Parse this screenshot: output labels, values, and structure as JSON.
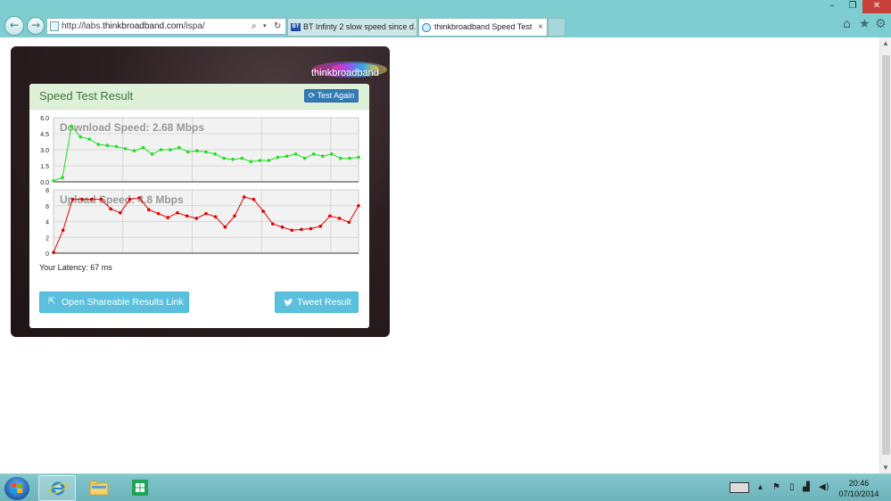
{
  "browser": {
    "url_prefix": "http://labs.",
    "url_host": "thinkbroadband.com",
    "url_path": "/ispa/",
    "tabs": [
      {
        "title": "BT Infinty 2 slow speed since d...",
        "icon": "bt-icon",
        "icon_text": "BT"
      },
      {
        "title": "thinkbroadband Speed Test",
        "icon": "ie-page-icon"
      }
    ],
    "controls": {
      "back": "back-arrow-icon",
      "forward": "forward-arrow-icon",
      "search": "⌕",
      "refresh": "↻",
      "home": "⌂",
      "favorites": "★",
      "tools": "⚙",
      "minimize": "–",
      "maximize": "❐",
      "close": "✕",
      "tab_close": "×"
    }
  },
  "widget": {
    "logo_text": "thinkbroadband",
    "title": "Speed Test Result",
    "test_again_label": "Test Again",
    "test_again_icon": "⟳",
    "latency_label": "Your Latency: 67 ms",
    "share_label": "Open Shareable Results Link",
    "share_icon": "⇱",
    "tweet_label": "Tweet Result",
    "tweet_icon": "twitter-bird-icon",
    "colors": {
      "download": "#22dd22",
      "upload": "#dd0000",
      "header_bg": "#dff0d8",
      "title": "#3c763d",
      "primary_btn": "#337ab7",
      "info_btn": "#5bc0de"
    }
  },
  "chart_data": [
    {
      "type": "line",
      "title": "Download Speed: 2.68 Mbps",
      "xlabel": "",
      "ylabel": "",
      "ylim": [
        0,
        6
      ],
      "yticks": [
        "0.0",
        "1.5",
        "3.0",
        "4.5",
        "6.0"
      ],
      "grid": true,
      "series": [
        {
          "name": "Download",
          "values": [
            0.1,
            0.4,
            5.2,
            4.2,
            4.0,
            3.5,
            3.4,
            3.3,
            3.1,
            2.9,
            3.2,
            2.6,
            3.0,
            3.0,
            3.2,
            2.8,
            2.9,
            2.8,
            2.6,
            2.2,
            2.1,
            2.2,
            1.9,
            2.0,
            2.0,
            2.3,
            2.4,
            2.6,
            2.2,
            2.6,
            2.4,
            2.6,
            2.2,
            2.2,
            2.3
          ]
        }
      ]
    },
    {
      "type": "line",
      "title": "Upload Speed: 4.8 Mbps",
      "xlabel": "",
      "ylabel": "",
      "ylim": [
        0,
        8
      ],
      "yticks": [
        "0",
        "2",
        "4",
        "6",
        "8"
      ],
      "grid": true,
      "series": [
        {
          "name": "Upload",
          "values": [
            0.1,
            2.9,
            6.8,
            6.8,
            6.8,
            6.8,
            5.6,
            5.1,
            6.8,
            7.0,
            5.5,
            5.0,
            4.5,
            5.1,
            4.7,
            4.4,
            5.0,
            4.6,
            3.3,
            4.7,
            7.1,
            6.8,
            5.3,
            3.7,
            3.3,
            2.9,
            3.0,
            3.1,
            3.4,
            4.7,
            4.4,
            3.9,
            6.0
          ]
        }
      ]
    }
  ],
  "taskbar": {
    "start": "windows-start-orb",
    "pinned": [
      "internet-explorer",
      "file-explorer",
      "windows-store"
    ],
    "tray_arrow": "▴",
    "time": "20:46",
    "date": "07/10/2014"
  }
}
